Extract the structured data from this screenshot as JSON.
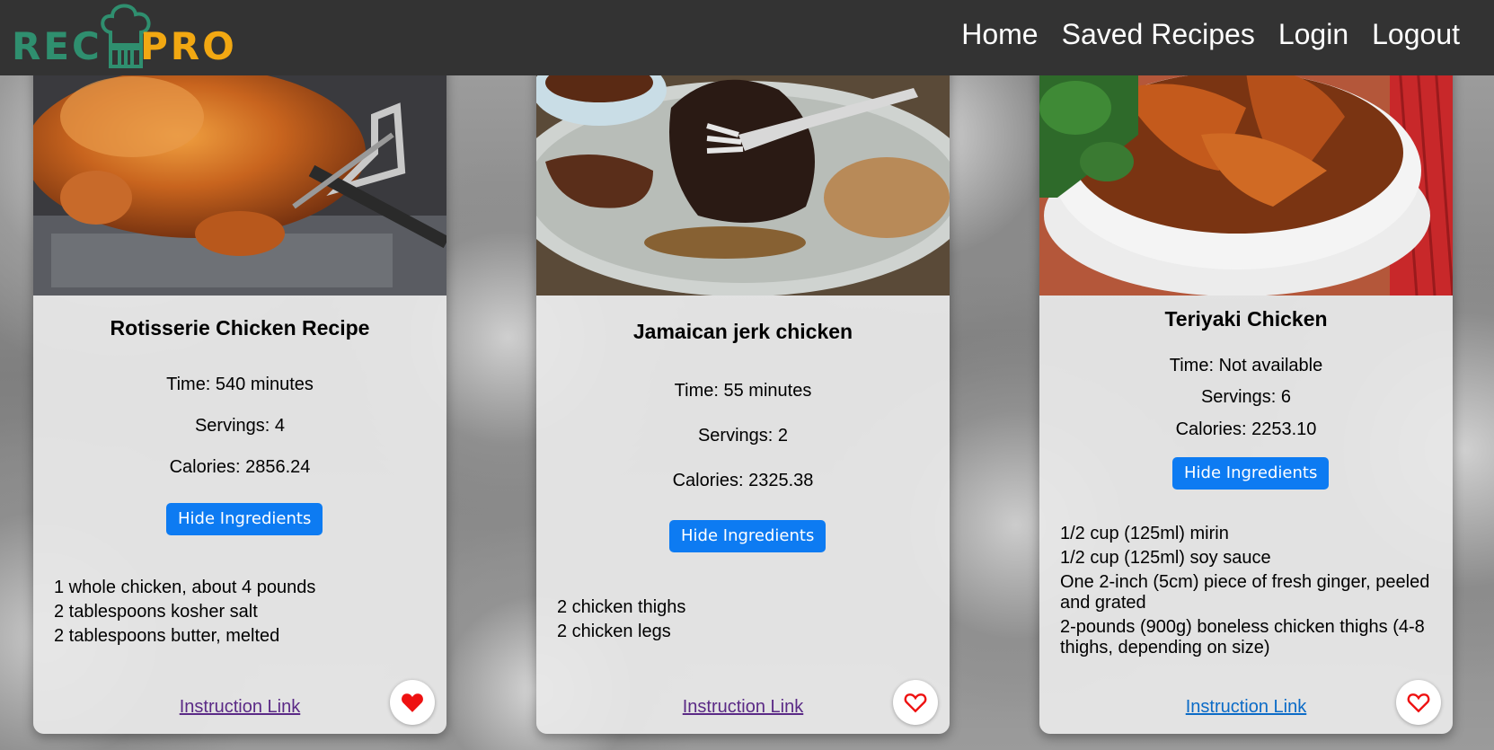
{
  "navbar": {
    "logo_left": "REC",
    "logo_right": "PRO",
    "links": [
      "Home",
      "Saved Recipes",
      "Login",
      "Logout"
    ]
  },
  "colors": {
    "navbar_bg": "#333333",
    "logo_green": "#2f8f6f",
    "logo_orange": "#f2a812",
    "button_blue": "#0d7bf2",
    "heart_red": "#ee1111",
    "link_visited": "#5b2a86",
    "link_default": "#0b6bc7"
  },
  "recipes": [
    {
      "title": "Rotisserie Chicken Recipe",
      "time": "Time: 540 minutes",
      "servings": "Servings: 4",
      "calories": "Calories: 2856.24",
      "toggle_label": "Hide Ingredients",
      "ingredients": [
        "1 whole chicken, about 4 pounds",
        "2 tablespoons kosher salt",
        "2 tablespoons butter, melted"
      ],
      "link_label": "Instruction Link",
      "saved": true,
      "image_icon": "rotisserie-chicken-photo"
    },
    {
      "title": "Jamaican jerk chicken",
      "time": "Time: 55 minutes",
      "servings": "Servings: 2",
      "calories": "Calories: 2325.38",
      "toggle_label": "Hide Ingredients",
      "ingredients": [
        "2 chicken thighs",
        "2 chicken legs"
      ],
      "link_label": "Instruction Link",
      "saved": false,
      "image_icon": "jerk-chicken-photo"
    },
    {
      "title": "Teriyaki Chicken",
      "time": "Time: Not available",
      "servings": "Servings: 6",
      "calories": "Calories: 2253.10",
      "toggle_label": "Hide Ingredients",
      "ingredients": [
        "1/2 cup (125ml) mirin",
        "1/2 cup (125ml) soy sauce",
        "One 2-inch (5cm) piece of fresh ginger, peeled and grated",
        "2-pounds (900g) boneless chicken thighs (4-8 thighs, depending on size)"
      ],
      "link_label": "Instruction Link",
      "saved": false,
      "image_icon": "teriyaki-chicken-photo"
    }
  ]
}
